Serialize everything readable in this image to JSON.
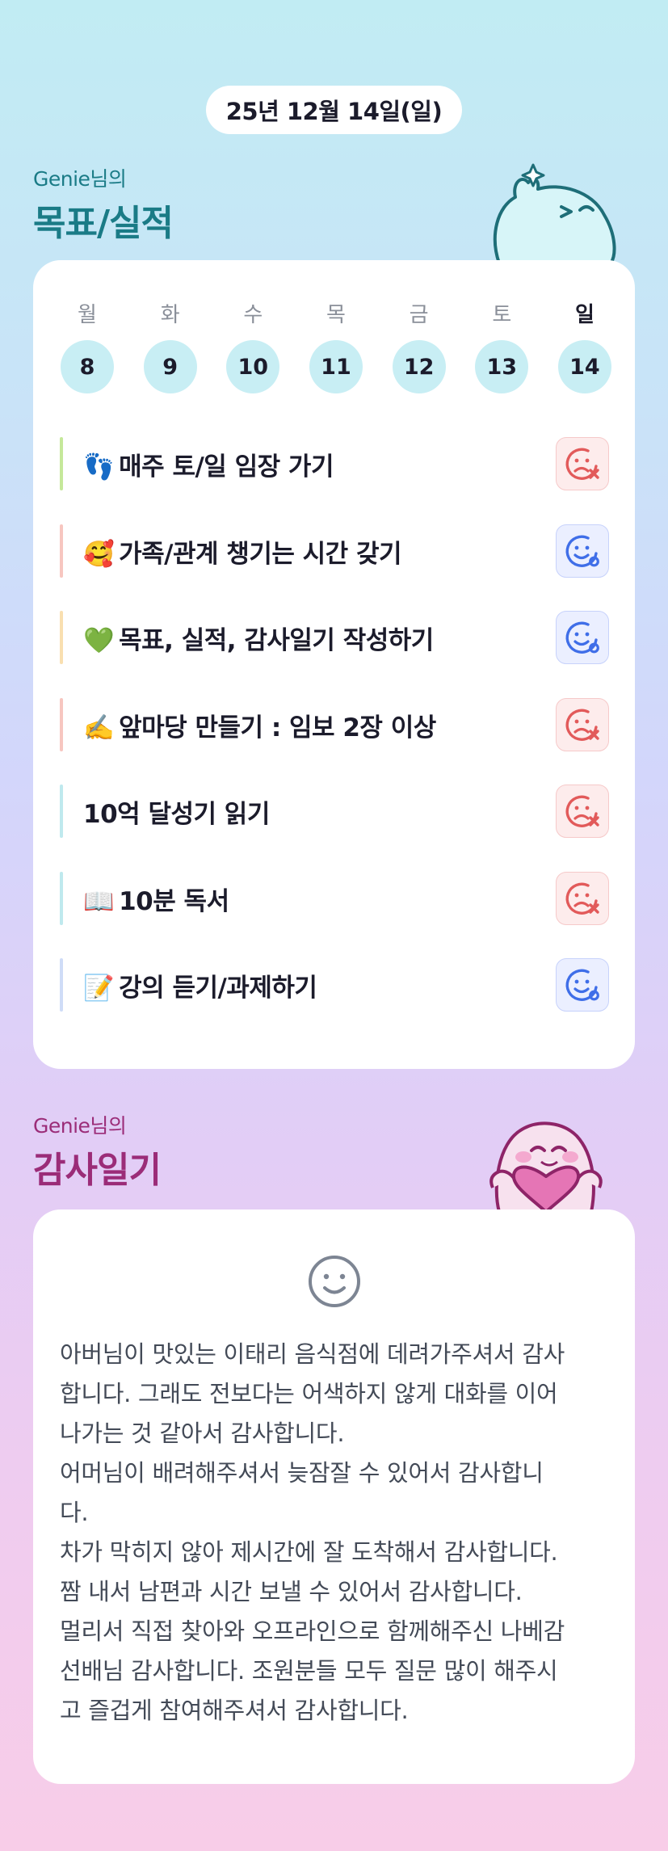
{
  "date": "25년 12월 14일(일)",
  "goals_section": {
    "subtitle": "Genie님의",
    "title": "목표/실적"
  },
  "week": {
    "days": [
      {
        "name": "월",
        "num": "8",
        "selected": false
      },
      {
        "name": "화",
        "num": "9",
        "selected": false
      },
      {
        "name": "수",
        "num": "10",
        "selected": false
      },
      {
        "name": "목",
        "num": "11",
        "selected": false
      },
      {
        "name": "금",
        "num": "12",
        "selected": false
      },
      {
        "name": "토",
        "num": "13",
        "selected": false
      },
      {
        "name": "일",
        "num": "14",
        "selected": true
      }
    ]
  },
  "goals": [
    {
      "emoji": "👣",
      "label": "매주 토/일 임장 가기",
      "status": "fail",
      "accent": "#c5e89a"
    },
    {
      "emoji": "🥰",
      "label": "가족/관계 챙기는 시간 갖기",
      "status": "done",
      "accent": "#f7c6c0"
    },
    {
      "emoji": "💚",
      "label": "목표, 실적, 감사일기 작성하기",
      "status": "done",
      "accent": "#f9dfb0"
    },
    {
      "emoji": "✍️",
      "label": "앞마당 만들기 : 임보 2장 이상",
      "status": "fail",
      "accent": "#f7c6c0"
    },
    {
      "emoji": "",
      "label": "10억 달성기 읽기",
      "status": "fail",
      "accent": "#bfe9ee"
    },
    {
      "emoji": "📖",
      "label": "10분 독서",
      "status": "fail",
      "accent": "#bfe9ee"
    },
    {
      "emoji": "📝",
      "label": "강의 듣기/과제하기",
      "status": "done",
      "accent": "#cfdcf7"
    }
  ],
  "gratitude_section": {
    "subtitle": "Genie님의",
    "title": "감사일기"
  },
  "gratitude": {
    "mood_icon": "smile-icon",
    "lines": [
      "아버님이 맛있는 이태리 음식점에 데려가주셔서 감사",
      "합니다. 그래도 전보다는 어색하지 않게 대화를 이어",
      "나가는 것 같아서 감사합니다.",
      "어머님이 배려해주셔서 늦잠잘 수 있어서 감사합니",
      "다.",
      "차가 막히지 않아 제시간에 잘 도착해서 감사합니다.",
      "짬 내서 남편과 시간 보낼 수 있어서 감사합니다.",
      "멀리서 직접 찾아와 오프라인으로 함께해주신 나베감",
      "선배님 감사합니다. 조원분들 모두 질문 많이 해주시",
      "고 즐겁게 참여해주셔서 감사합니다."
    ]
  },
  "colors": {
    "goals_title": "#1a7b86",
    "gratitude_title": "#9b2c78",
    "fail": "#e25a5a",
    "done": "#3f6ee8",
    "day_circle": "#c8eef4"
  }
}
